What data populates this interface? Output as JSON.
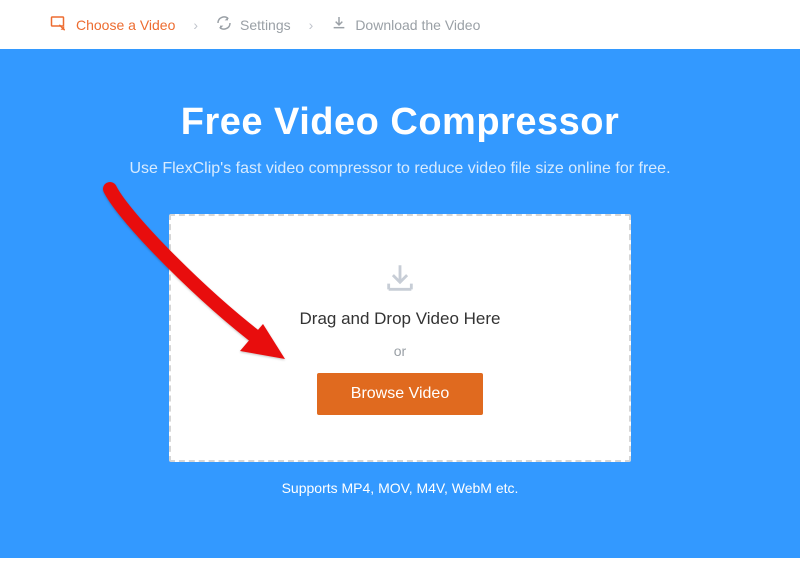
{
  "steps": {
    "step1": {
      "label": "Choose a Video"
    },
    "step2": {
      "label": "Settings"
    },
    "step3": {
      "label": "Download the Video"
    }
  },
  "hero": {
    "title": "Free Video Compressor",
    "subtitle": "Use FlexClip's fast video compressor to reduce video file size online for free."
  },
  "dropzone": {
    "main": "Drag and Drop Video Here",
    "or": "or",
    "button": "Browse Video"
  },
  "supports": "Supports MP4, MOV, M4V, WebM etc.",
  "colors": {
    "accent": "#ed6c30",
    "hero_bg": "#3399ff",
    "button_bg": "#e06a1f"
  }
}
